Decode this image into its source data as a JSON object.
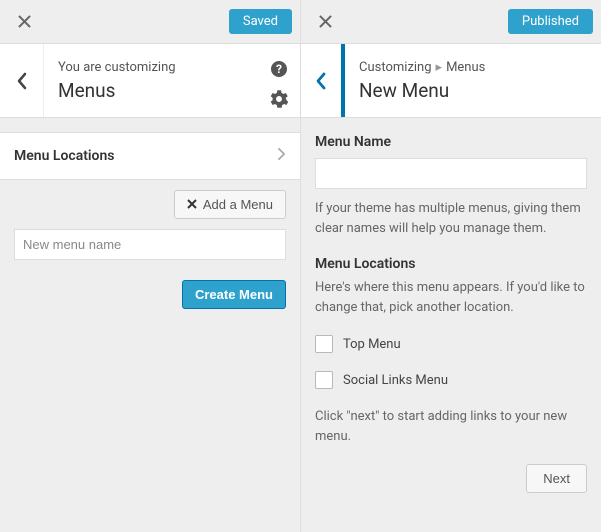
{
  "left": {
    "status": "Saved",
    "subtitle": "You are customizing",
    "title": "Menus",
    "section": "Menu Locations",
    "addMenu": "Add a Menu",
    "newMenuPlaceholder": "New menu name",
    "createMenu": "Create Menu"
  },
  "right": {
    "status": "Published",
    "breadcrumb1": "Customizing",
    "breadcrumb2": "Menus",
    "title": "New Menu",
    "menuNameLabel": "Menu Name",
    "menuNameHelp": "If your theme has multiple menus, giving them clear names will help you manage them.",
    "locationsTitle": "Menu Locations",
    "locationsHelp": "Here's where this menu appears. If you'd like to change that, pick another location.",
    "loc1": "Top Menu",
    "loc2": "Social Links Menu",
    "nextHelp": "Click \"next\" to start adding links to your new menu.",
    "nextBtn": "Next"
  }
}
